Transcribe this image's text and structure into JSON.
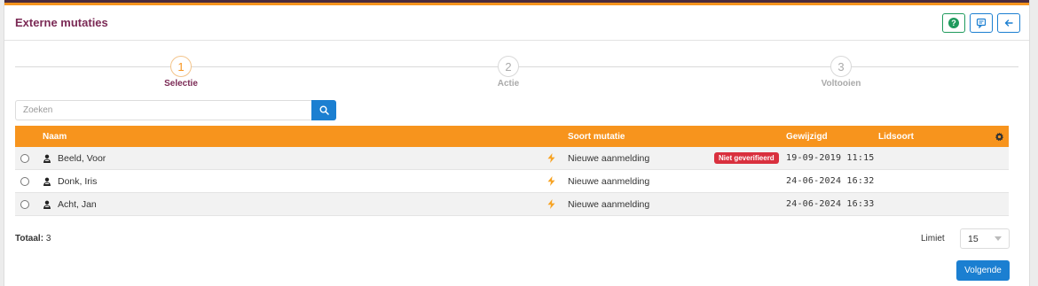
{
  "header": {
    "title": "Externe mutaties",
    "buttons": [
      "help-icon",
      "comment-icon",
      "arrow-left-icon"
    ]
  },
  "stepper": {
    "steps": [
      {
        "number": "1",
        "label": "Selectie",
        "active": true
      },
      {
        "number": "2",
        "label": "Actie",
        "active": false
      },
      {
        "number": "3",
        "label": "Voltooien",
        "active": false
      }
    ]
  },
  "search": {
    "placeholder": "Zoeken",
    "value": ""
  },
  "table": {
    "columns": {
      "naam": "Naam",
      "soort": "Soort mutatie",
      "gewijzigd": "Gewijzigd",
      "lidsoort": "Lidsoort"
    },
    "rows": [
      {
        "naam": "Beeld, Voor",
        "soort": "Nieuwe aanmelding",
        "badge": "Niet geverifieerd",
        "gewijzigd": "19-09-2019 11:15",
        "lidsoort": ""
      },
      {
        "naam": "Donk, Iris",
        "soort": "Nieuwe aanmelding",
        "badge": "",
        "gewijzigd": "24-06-2024 16:32",
        "lidsoort": ""
      },
      {
        "naam": "Acht, Jan",
        "soort": "Nieuwe aanmelding",
        "badge": "",
        "gewijzigd": "24-06-2024 16:33",
        "lidsoort": ""
      }
    ]
  },
  "footer": {
    "totaal_label": "Totaal:",
    "totaal_value": "3",
    "limiet_label": "Limiet",
    "limiet_value": "15",
    "next_label": "Volgende"
  },
  "colors": {
    "accent": "#f7941d",
    "title": "#7b2a55",
    "primary": "#1b7fd1",
    "badge": "#d9303e"
  }
}
